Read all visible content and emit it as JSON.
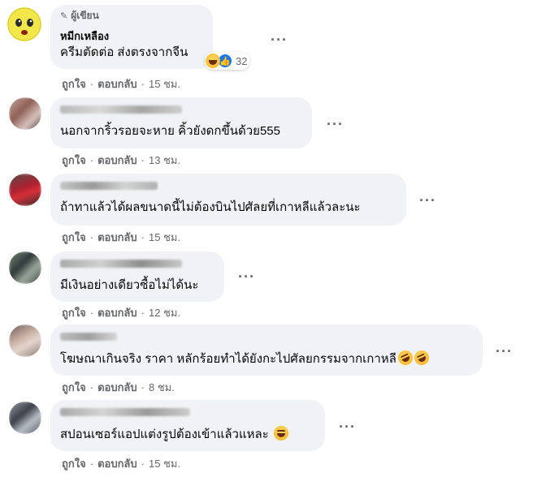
{
  "comments": [
    {
      "badge": "ผู้เขียน",
      "author": "หมีกเหลือง",
      "text": "ครีมตัดต่อ ส่งตรงจากจีน",
      "reaction_count": "32",
      "like": "ถูกใจ",
      "reply": "ตอบกลับ",
      "time": "15 ชม."
    },
    {
      "text": "นอกจากริ้วรอยจะหาย คิ้วยังดกขึ้นด้วย555",
      "like": "ถูกใจ",
      "reply": "ตอบกลับ",
      "time": "13 ชม."
    },
    {
      "text": "ถ้าทาแล้วได้ผลขนาดนี้ไม่ต้องบินไปศัลยที่เกาหลีแล้วละนะ",
      "like": "ถูกใจ",
      "reply": "ตอบกลับ",
      "time": "15 ชม."
    },
    {
      "text": "มีเงินอย่างเดียวซื้อไม่ได้นะ",
      "like": "ถูกใจ",
      "reply": "ตอบกลับ",
      "time": "12 ชม."
    },
    {
      "text": "โฆษณาเกินจริง ราคา หลักร้อยทำได้ยังกะไปศัลยกรรมจากเกาหลี",
      "like": "ถูกใจ",
      "reply": "ตอบกลับ",
      "time": "8 ชม."
    },
    {
      "text": "สปอนเซอร์แอปแต่งรูปต้องเข้าแล้วแหละ",
      "like": "ถูกใจ",
      "reply": "ตอบกลับ",
      "time": "15 ชม."
    }
  ],
  "more_glyph": "···",
  "separator": "·",
  "colors": {
    "bubble": "#f0f2f5",
    "secondary_text": "#65676b",
    "like_blue": "#1877f2"
  }
}
